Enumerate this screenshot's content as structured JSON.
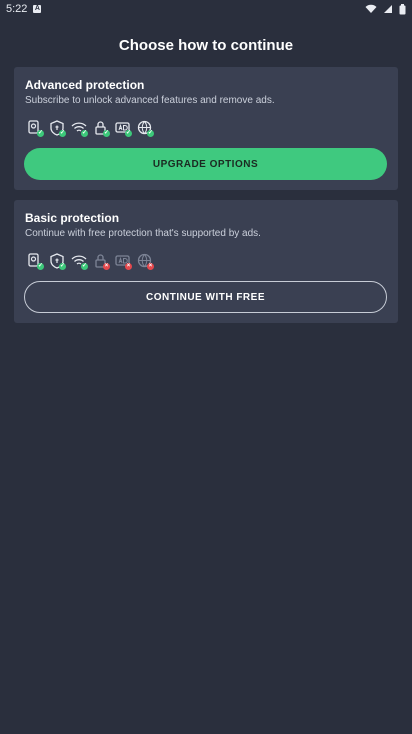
{
  "status_bar": {
    "time": "5:22",
    "icons": [
      "app-icon",
      "wifi-icon",
      "signal-icon",
      "battery-icon"
    ]
  },
  "title": "Choose how to continue",
  "advanced": {
    "title": "Advanced protection",
    "subtitle": "Subscribe to unlock advanced features and remove ads.",
    "features": [
      {
        "icon": "scan-icon",
        "enabled": true
      },
      {
        "icon": "shield-icon",
        "enabled": true
      },
      {
        "icon": "wifi-security-icon",
        "enabled": true
      },
      {
        "icon": "lock-icon",
        "enabled": true
      },
      {
        "icon": "ad-block-icon",
        "enabled": true
      },
      {
        "icon": "web-shield-icon",
        "enabled": true
      }
    ],
    "button_label": "UPGRADE OPTIONS"
  },
  "basic": {
    "title": "Basic protection",
    "subtitle": "Continue with free protection that's supported by ads.",
    "features": [
      {
        "icon": "scan-icon",
        "enabled": true
      },
      {
        "icon": "shield-icon",
        "enabled": true
      },
      {
        "icon": "wifi-security-icon",
        "enabled": true
      },
      {
        "icon": "lock-icon",
        "enabled": false
      },
      {
        "icon": "ad-block-icon",
        "enabled": false
      },
      {
        "icon": "web-shield-icon",
        "enabled": false
      }
    ],
    "button_label": "CONTINUE WITH FREE"
  },
  "colors": {
    "background": "#2a2f3d",
    "card": "#3a4052",
    "accent": "#3fc97f",
    "enabled": "#3cc97a",
    "disabled": "#e5484d"
  }
}
